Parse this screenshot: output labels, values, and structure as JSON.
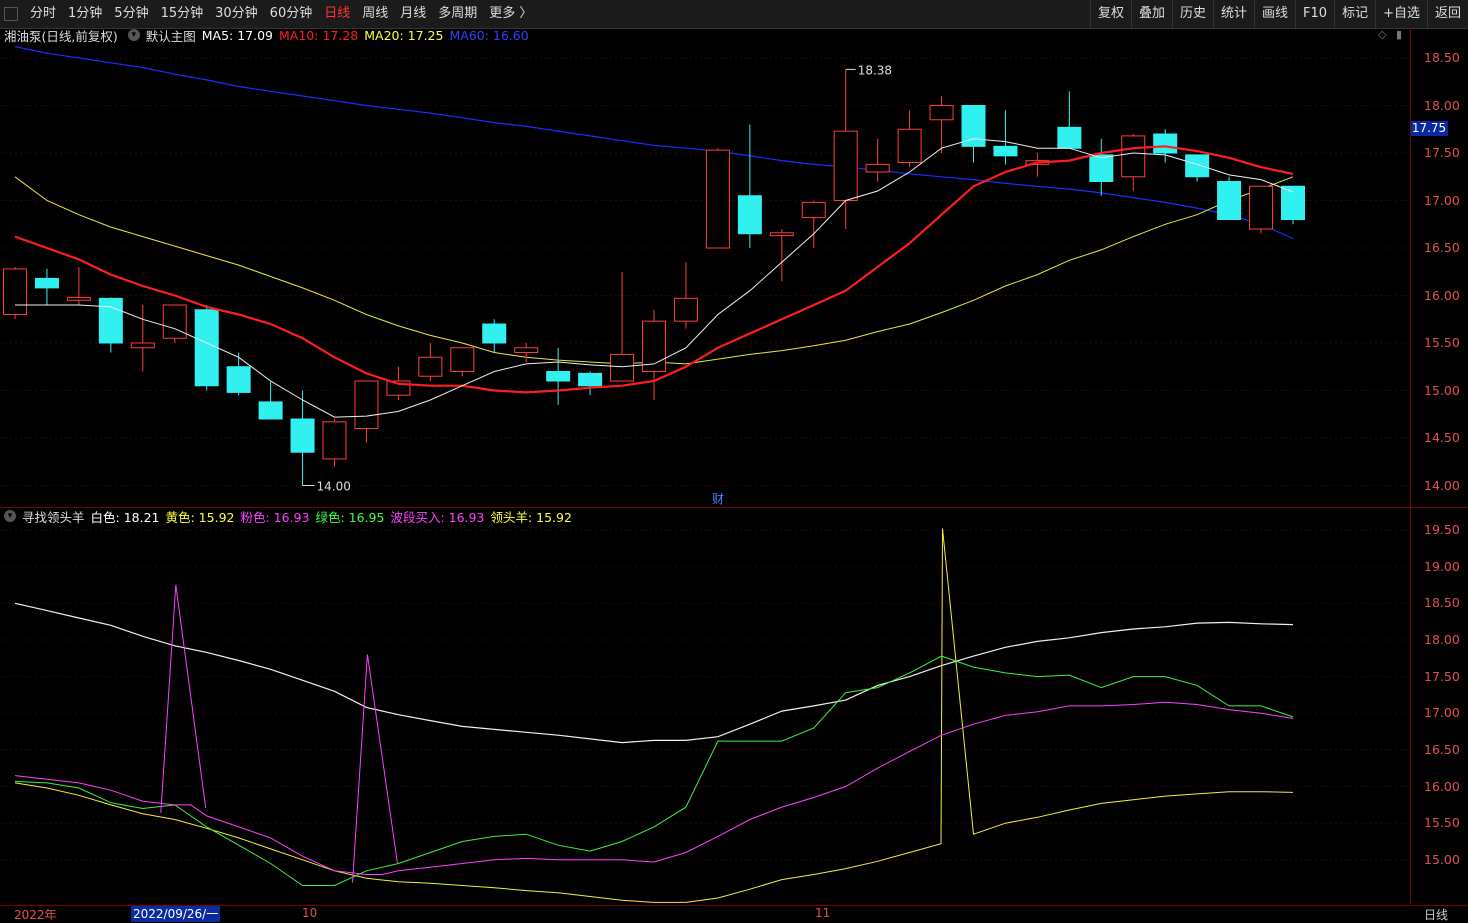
{
  "toolbar": {
    "periods": [
      "分时",
      "1分钟",
      "5分钟",
      "15分钟",
      "30分钟",
      "60分钟",
      "日线",
      "周线",
      "月线",
      "多周期",
      "更多 〉"
    ],
    "active_period": "日线",
    "right": [
      "复权",
      "叠加",
      "历史",
      "统计",
      "画线",
      "F10",
      "标记",
      "+自选",
      "返回"
    ]
  },
  "main_pane": {
    "stock": "湘油泵(日线,前复权)",
    "chart_name": "默认主图",
    "ma": [
      {
        "label": "MA5: 17.09",
        "color": "#ffffff"
      },
      {
        "label": "MA10: 17.28",
        "color": "#ff2020"
      },
      {
        "label": "MA20: 17.25",
        "color": "#ffff40"
      },
      {
        "label": "MA60: 16.60",
        "color": "#2030ff"
      }
    ],
    "current_price": "17.75",
    "high_label": "18.38",
    "low_label": "14.00",
    "fin_marker": "财",
    "y_ticks": [
      "18.50",
      "18.00",
      "17.50",
      "17.00",
      "16.50",
      "16.00",
      "15.50",
      "15.00",
      "14.50",
      "14.00"
    ]
  },
  "indicator_pane": {
    "name": "寻找领头羊",
    "values": [
      {
        "label": "白色: 18.21",
        "color": "#ffffff"
      },
      {
        "label": "黄色: 15.92",
        "color": "#ffff40"
      },
      {
        "label": "粉色: 16.93",
        "color": "#ff40ff"
      },
      {
        "label": "绿色: 16.95",
        "color": "#40ff40"
      },
      {
        "label": "波段买入: 16.93",
        "color": "#ff40ff"
      },
      {
        "label": "领头羊: 15.92",
        "color": "#ffff40"
      }
    ],
    "y_ticks": [
      "19.50",
      "19.00",
      "18.50",
      "18.00",
      "17.50",
      "17.00",
      "16.50",
      "16.00",
      "15.50",
      "15.00"
    ]
  },
  "x_axis": {
    "labels": [
      "2022年",
      "10",
      "11"
    ],
    "selected": "2022/09/26/一",
    "period": "日线"
  },
  "chart_data": {
    "type": "candlestick",
    "candles": [
      {
        "o": 15.8,
        "h": 16.3,
        "l": 15.75,
        "c": 16.28
      },
      {
        "o": 16.18,
        "h": 16.28,
        "l": 15.9,
        "c": 16.08
      },
      {
        "o": 15.95,
        "h": 16.3,
        "l": 15.9,
        "c": 15.98
      },
      {
        "o": 15.97,
        "h": 15.98,
        "l": 15.4,
        "c": 15.5
      },
      {
        "o": 15.45,
        "h": 15.9,
        "l": 15.2,
        "c": 15.5
      },
      {
        "o": 15.55,
        "h": 15.9,
        "l": 15.5,
        "c": 15.9
      },
      {
        "o": 15.85,
        "h": 15.9,
        "l": 15.0,
        "c": 15.05
      },
      {
        "o": 15.25,
        "h": 15.4,
        "l": 14.95,
        "c": 14.98
      },
      {
        "o": 14.88,
        "h": 15.1,
        "l": 14.7,
        "c": 14.7
      },
      {
        "o": 14.7,
        "h": 15.0,
        "l": 14.0,
        "c": 14.35
      },
      {
        "o": 14.28,
        "h": 14.7,
        "l": 14.2,
        "c": 14.67
      },
      {
        "o": 14.6,
        "h": 15.1,
        "l": 14.45,
        "c": 15.1
      },
      {
        "o": 14.95,
        "h": 15.25,
        "l": 14.9,
        "c": 15.1
      },
      {
        "o": 15.15,
        "h": 15.5,
        "l": 15.1,
        "c": 15.35
      },
      {
        "o": 15.2,
        "h": 15.45,
        "l": 15.15,
        "c": 15.45
      },
      {
        "o": 15.7,
        "h": 15.75,
        "l": 15.4,
        "c": 15.5
      },
      {
        "o": 15.4,
        "h": 15.5,
        "l": 15.3,
        "c": 15.45
      },
      {
        "o": 15.2,
        "h": 15.45,
        "l": 14.85,
        "c": 15.1
      },
      {
        "o": 15.18,
        "h": 15.2,
        "l": 14.95,
        "c": 15.05
      },
      {
        "o": 15.1,
        "h": 16.25,
        "l": 15.1,
        "c": 15.38
      },
      {
        "o": 15.2,
        "h": 15.85,
        "l": 14.9,
        "c": 15.73
      },
      {
        "o": 15.73,
        "h": 16.35,
        "l": 15.65,
        "c": 15.97
      },
      {
        "o": 16.5,
        "h": 17.55,
        "l": 16.5,
        "c": 17.53
      },
      {
        "o": 17.05,
        "h": 17.8,
        "l": 16.5,
        "c": 16.65
      },
      {
        "o": 16.63,
        "h": 16.7,
        "l": 16.15,
        "c": 16.66
      },
      {
        "o": 16.82,
        "h": 17.0,
        "l": 16.5,
        "c": 16.98
      },
      {
        "o": 17.0,
        "h": 18.38,
        "l": 16.7,
        "c": 17.73
      },
      {
        "o": 17.3,
        "h": 17.65,
        "l": 17.2,
        "c": 17.38
      },
      {
        "o": 17.4,
        "h": 17.95,
        "l": 17.35,
        "c": 17.75
      },
      {
        "o": 17.85,
        "h": 18.1,
        "l": 17.5,
        "c": 18.0
      },
      {
        "o": 18.0,
        "h": 18.0,
        "l": 17.4,
        "c": 17.57
      },
      {
        "o": 17.57,
        "h": 17.95,
        "l": 17.38,
        "c": 17.47
      },
      {
        "o": 17.38,
        "h": 17.5,
        "l": 17.25,
        "c": 17.42
      },
      {
        "o": 17.77,
        "h": 18.15,
        "l": 17.55,
        "c": 17.55
      },
      {
        "o": 17.48,
        "h": 17.65,
        "l": 17.05,
        "c": 17.2
      },
      {
        "o": 17.25,
        "h": 17.7,
        "l": 17.1,
        "c": 17.68
      },
      {
        "o": 17.7,
        "h": 17.75,
        "l": 17.4,
        "c": 17.5
      },
      {
        "o": 17.48,
        "h": 17.48,
        "l": 17.2,
        "c": 17.25
      },
      {
        "o": 17.2,
        "h": 17.25,
        "l": 16.8,
        "c": 16.8
      },
      {
        "o": 16.7,
        "h": 17.15,
        "l": 16.65,
        "c": 17.15
      },
      {
        "o": 17.15,
        "h": 17.15,
        "l": 16.75,
        "c": 16.8
      }
    ],
    "ma5": [
      15.9,
      15.9,
      15.9,
      15.88,
      15.75,
      15.65,
      15.5,
      15.35,
      15.1,
      14.9,
      14.72,
      14.73,
      14.78,
      14.9,
      15.05,
      15.2,
      15.28,
      15.3,
      15.27,
      15.25,
      15.28,
      15.45,
      15.8,
      16.05,
      16.35,
      16.65,
      17.0,
      17.1,
      17.3,
      17.55,
      17.65,
      17.62,
      17.55,
      17.55,
      17.45,
      17.5,
      17.48,
      17.38,
      17.27,
      17.22,
      17.09
    ],
    "ma10": [
      16.62,
      16.5,
      16.38,
      16.22,
      16.1,
      16.0,
      15.88,
      15.8,
      15.7,
      15.55,
      15.35,
      15.18,
      15.07,
      15.05,
      15.05,
      15.0,
      14.98,
      15.0,
      15.03,
      15.05,
      15.1,
      15.25,
      15.45,
      15.6,
      15.75,
      15.9,
      16.05,
      16.3,
      16.55,
      16.85,
      17.15,
      17.3,
      17.4,
      17.42,
      17.5,
      17.55,
      17.57,
      17.52,
      17.45,
      17.35,
      17.28
    ],
    "ma20": [
      17.25,
      17.0,
      16.85,
      16.72,
      16.62,
      16.52,
      16.42,
      16.32,
      16.2,
      16.08,
      15.95,
      15.8,
      15.68,
      15.58,
      15.5,
      15.4,
      15.35,
      15.32,
      15.3,
      15.28,
      15.3,
      15.28,
      15.33,
      15.38,
      15.42,
      15.47,
      15.53,
      15.62,
      15.7,
      15.82,
      15.95,
      16.1,
      16.22,
      16.37,
      16.48,
      16.62,
      16.75,
      16.85,
      17.0,
      17.12,
      17.25
    ],
    "ma60": [
      18.62,
      18.55,
      18.5,
      18.45,
      18.4,
      18.33,
      18.27,
      18.2,
      18.15,
      18.1,
      18.05,
      18.0,
      17.96,
      17.92,
      17.87,
      17.82,
      17.78,
      17.73,
      17.68,
      17.63,
      17.58,
      17.55,
      17.52,
      17.47,
      17.42,
      17.38,
      17.35,
      17.32,
      17.28,
      17.25,
      17.22,
      17.18,
      17.15,
      17.12,
      17.08,
      17.03,
      16.98,
      16.92,
      16.85,
      16.75,
      16.6
    ],
    "ind_white": [
      18.5,
      18.4,
      18.3,
      18.2,
      18.05,
      17.92,
      17.83,
      17.72,
      17.6,
      17.45,
      17.3,
      17.08,
      16.98,
      16.9,
      16.82,
      16.78,
      16.74,
      16.7,
      16.65,
      16.6,
      16.63,
      16.63,
      16.68,
      16.85,
      17.03,
      17.1,
      17.18,
      17.38,
      17.5,
      17.65,
      17.78,
      17.9,
      17.98,
      18.03,
      18.1,
      18.15,
      18.18,
      18.23,
      18.24,
      18.22,
      18.21
    ],
    "ind_yellow": [
      16.05,
      15.98,
      15.88,
      15.75,
      15.63,
      15.55,
      15.43,
      15.3,
      15.15,
      15.0,
      14.85,
      14.75,
      14.7,
      14.68,
      14.65,
      14.62,
      14.58,
      14.55,
      14.5,
      14.45,
      14.42,
      14.42,
      14.48,
      14.6,
      14.73,
      14.8,
      14.88,
      14.98,
      15.1,
      15.22,
      15.35,
      15.5,
      15.58,
      15.68,
      15.77,
      15.82,
      15.87,
      15.9,
      15.93,
      15.93,
      15.92
    ],
    "ind_pink": [
      16.15,
      16.1,
      16.05,
      15.95,
      15.8,
      15.75,
      15.6,
      15.45,
      15.3,
      15.05,
      14.85,
      14.8,
      14.85,
      14.9,
      14.95,
      15.0,
      15.02,
      15.0,
      15.0,
      15.0,
      14.97,
      15.1,
      15.32,
      15.55,
      15.72,
      15.85,
      16.0,
      16.25,
      16.48,
      16.7,
      16.85,
      16.97,
      17.02,
      17.1,
      17.1,
      17.12,
      17.15,
      17.12,
      17.05,
      17.0,
      16.93
    ],
    "ind_green": [
      16.07,
      16.05,
      15.98,
      15.78,
      15.7,
      15.75,
      15.45,
      15.2,
      14.95,
      14.65,
      14.65,
      14.85,
      14.95,
      15.1,
      15.25,
      15.32,
      15.35,
      15.2,
      15.12,
      15.25,
      15.45,
      15.72,
      16.62,
      16.62,
      16.62,
      16.8,
      17.28,
      17.35,
      17.55,
      17.78,
      17.63,
      17.55,
      17.5,
      17.52,
      17.35,
      17.5,
      17.5,
      17.38,
      17.1,
      17.1,
      16.95
    ],
    "spikes_pink": [
      {
        "i": 5,
        "v": 18.75
      },
      {
        "i": 11,
        "v": 17.8
      }
    ],
    "spike_yellow": {
      "i": 29,
      "v": 19.52
    }
  }
}
